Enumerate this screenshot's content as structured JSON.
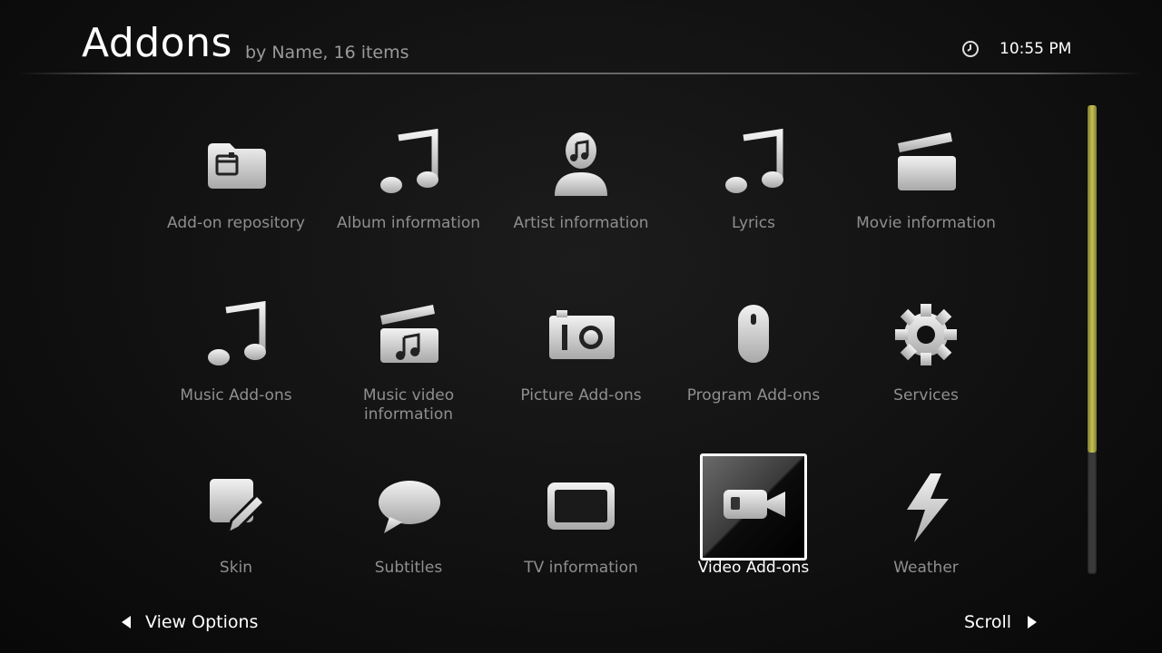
{
  "header": {
    "title": "Addons",
    "subtitle": "by Name, 16 items",
    "time": "10:55 PM"
  },
  "items": [
    {
      "label": "Add-on repository",
      "icon": "folder-icon"
    },
    {
      "label": "Album information",
      "icon": "music-note-icon"
    },
    {
      "label": "Artist information",
      "icon": "artist-icon"
    },
    {
      "label": "Lyrics",
      "icon": "music-note-icon"
    },
    {
      "label": "Movie information",
      "icon": "clapperboard-icon"
    },
    {
      "label": "Music Add-ons",
      "icon": "music-note-icon"
    },
    {
      "label": "Music video\ninformation",
      "icon": "music-clapperboard-icon"
    },
    {
      "label": "Picture Add-ons",
      "icon": "camera-icon"
    },
    {
      "label": "Program Add-ons",
      "icon": "mouse-icon"
    },
    {
      "label": "Services",
      "icon": "gear-icon"
    },
    {
      "label": "Skin",
      "icon": "pencil-icon"
    },
    {
      "label": "Subtitles",
      "icon": "speech-bubble-icon"
    },
    {
      "label": "TV information",
      "icon": "tv-icon"
    },
    {
      "label": "Video Add-ons",
      "icon": "video-camera-icon",
      "selected": true
    },
    {
      "label": "Weather",
      "icon": "lightning-icon"
    }
  ],
  "scroll": {
    "thumb_fraction": 0.74
  },
  "footer": {
    "left_label": "View Options",
    "right_label": "Scroll"
  },
  "colors": {
    "accent": "#c8c250",
    "label": "#8f8f8f",
    "icon": "#d8d8d8"
  }
}
